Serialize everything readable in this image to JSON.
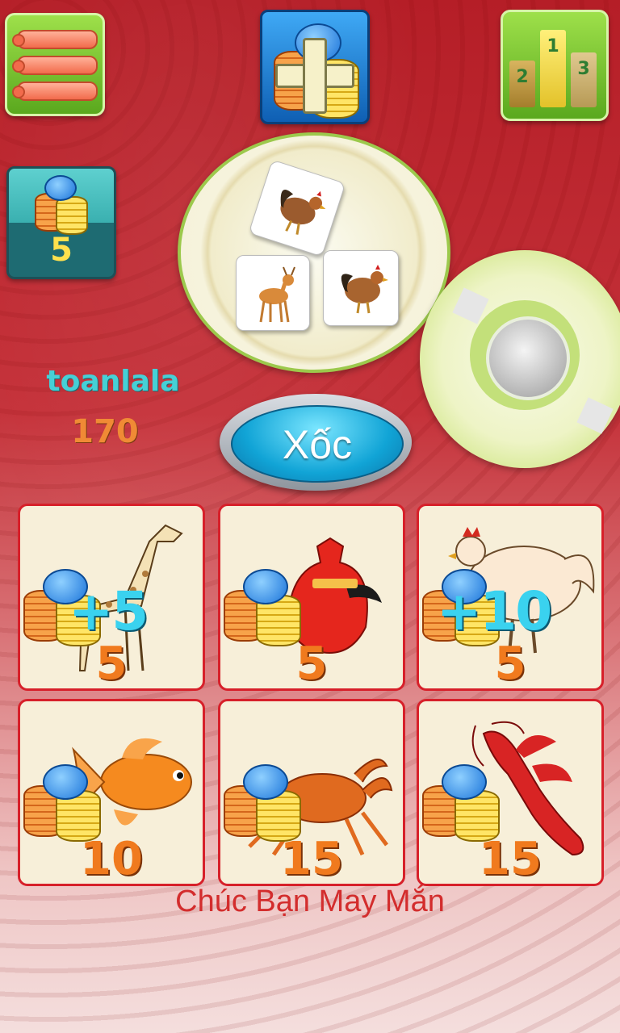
{
  "balance": {
    "value": "5",
    "icon": "coin-stack-icon"
  },
  "player": {
    "name": "toanlala",
    "score": "170"
  },
  "plate": {
    "dice": [
      {
        "animal": "rooster"
      },
      {
        "animal": "deer"
      },
      {
        "animal": "rooster"
      }
    ]
  },
  "shake_button": {
    "label": "Xốc"
  },
  "rank_icon": {
    "labels": [
      "2",
      "1",
      "3"
    ]
  },
  "bet_board": [
    {
      "animal": "giraffe",
      "bet": "5",
      "bonus": "+5"
    },
    {
      "animal": "gourd",
      "bet": "5",
      "bonus": ""
    },
    {
      "animal": "chicken",
      "bet": "5",
      "bonus": "+10"
    },
    {
      "animal": "fish",
      "bet": "10",
      "bonus": ""
    },
    {
      "animal": "crab",
      "bet": "15",
      "bonus": ""
    },
    {
      "animal": "lobster",
      "bet": "15",
      "bonus": ""
    }
  ],
  "footer": {
    "message": "Chúc Bạn May Mắn"
  },
  "colors": {
    "accent_red": "#d7202a",
    "bet_orange": "#f07a1e",
    "bonus_cyan": "#3ad2ef",
    "name_teal": "#46d0d6"
  }
}
